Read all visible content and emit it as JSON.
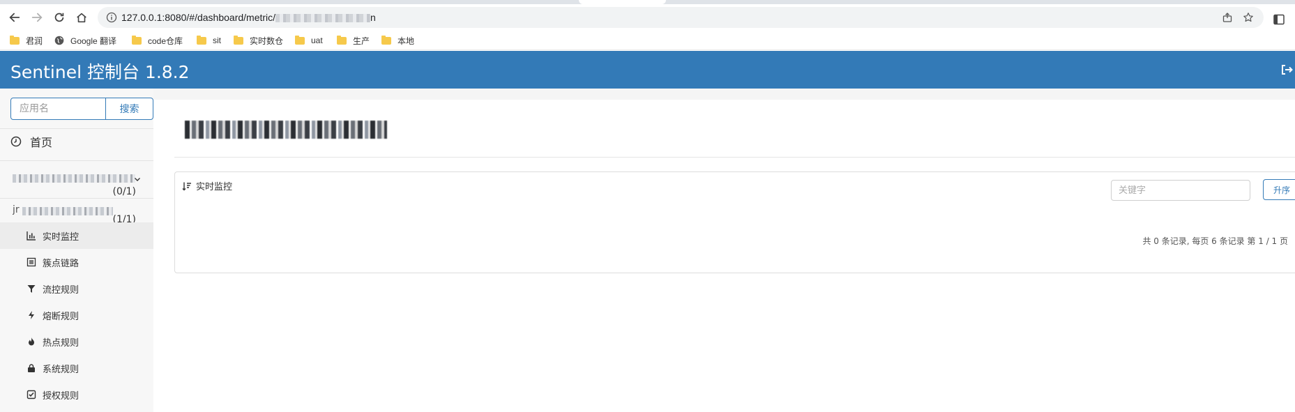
{
  "browser": {
    "url_prefix": "127.0.0.1:8080/#/dashboard/metric/",
    "url_suffix": "n",
    "bookmarks": [
      {
        "label": "君润",
        "icon": "folder-icon"
      },
      {
        "label": "Google 翻译",
        "icon": "globe-icon"
      },
      {
        "label": "code仓库",
        "icon": "folder-icon"
      },
      {
        "label": "sit",
        "icon": "folder-icon"
      },
      {
        "label": "实时数仓",
        "icon": "folder-icon"
      },
      {
        "label": "uat",
        "icon": "folder-icon"
      },
      {
        "label": "生产",
        "icon": "folder-icon"
      },
      {
        "label": "本地",
        "icon": "folder-icon"
      }
    ]
  },
  "header": {
    "brand": "Sentinel 控制台 1.8.2"
  },
  "sidebar": {
    "search_placeholder": "应用名",
    "search_button": "搜索",
    "home": "首页",
    "apps": [
      {
        "count": "(0/1)"
      },
      {
        "count": "(1/1)"
      }
    ],
    "menu": [
      {
        "label": "实时监控",
        "icon": "bar-chart-icon",
        "active": true
      },
      {
        "label": "簇点链路",
        "icon": "list-icon",
        "active": false
      },
      {
        "label": "流控规则",
        "icon": "filter-icon",
        "active": false
      },
      {
        "label": "熔断规则",
        "icon": "bolt-icon",
        "active": false
      },
      {
        "label": "热点规则",
        "icon": "fire-icon",
        "active": false
      },
      {
        "label": "系统规则",
        "icon": "lock-icon",
        "active": false
      },
      {
        "label": "授权规则",
        "icon": "check-square-icon",
        "active": false
      }
    ]
  },
  "main": {
    "panel_title": "实时监控",
    "keyword_placeholder": "关键字",
    "sort_button": "升序",
    "pagination": "共 0 条记录, 每页 6 条记录 第 1 / 1 页"
  },
  "colors": {
    "brand_blue": "#337ab7",
    "folder_yellow": "#f6c94b"
  }
}
